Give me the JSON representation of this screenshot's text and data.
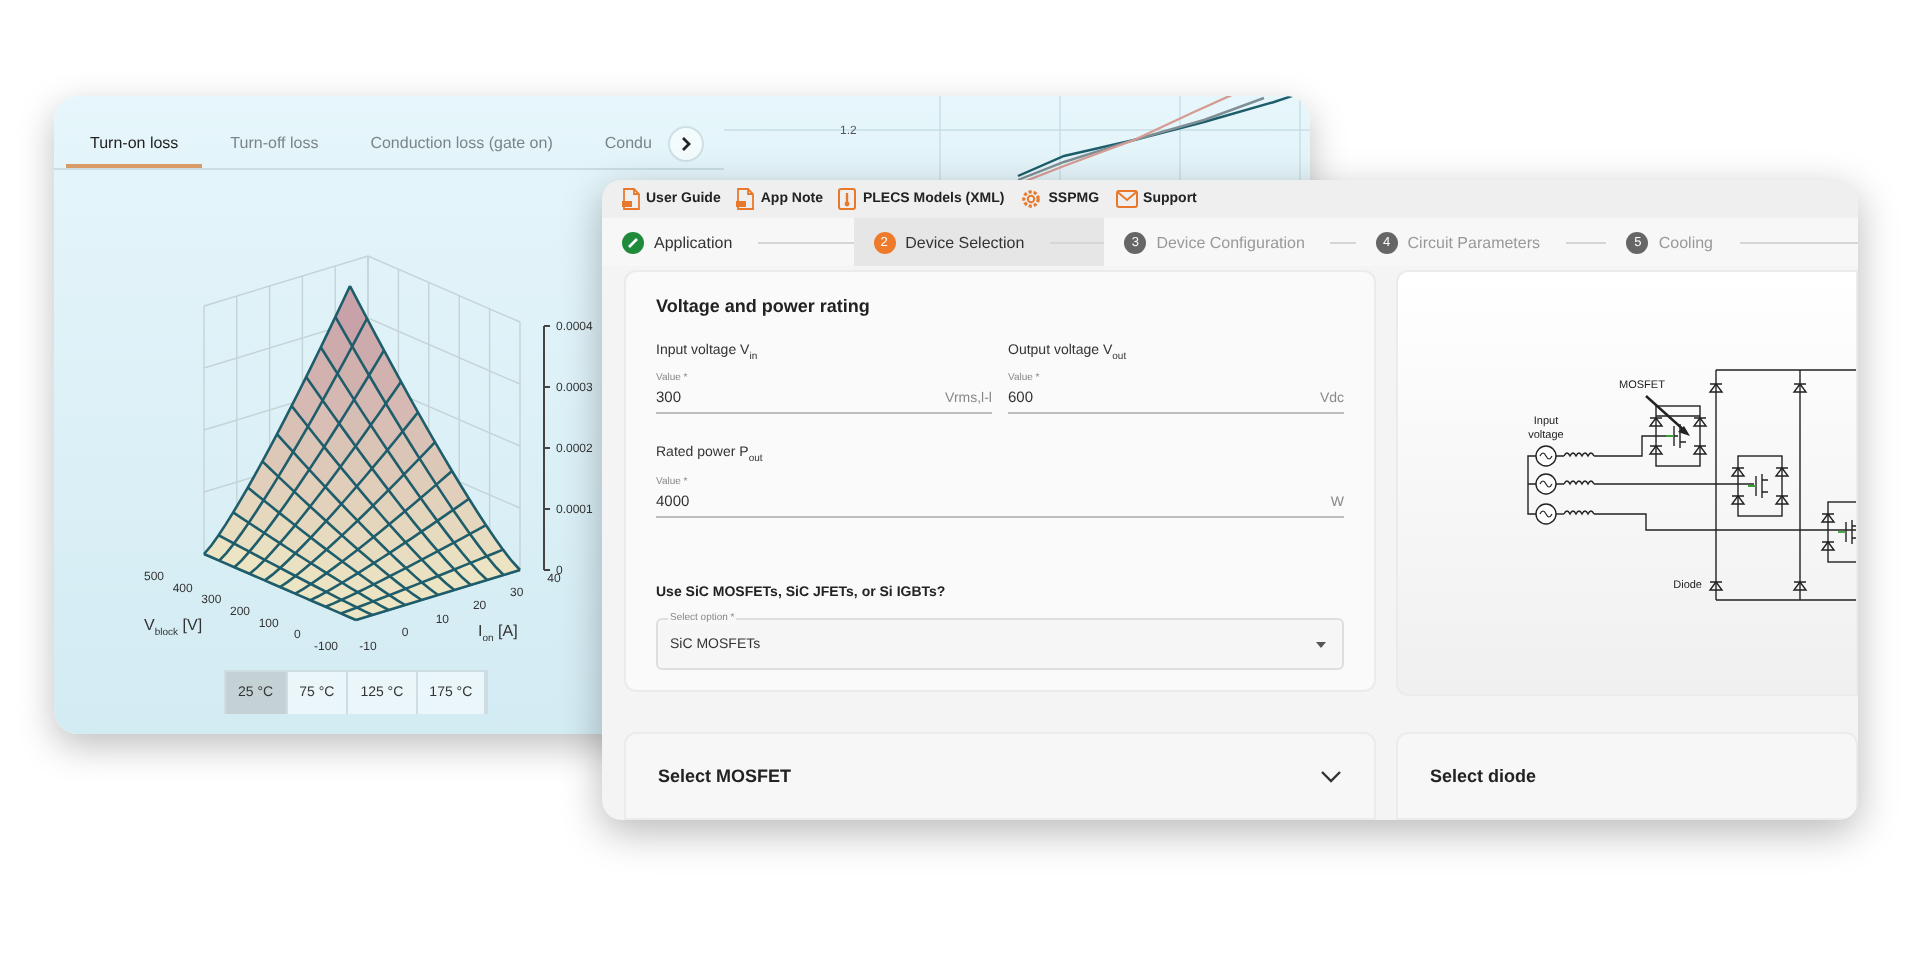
{
  "back_window": {
    "tabs": [
      {
        "label": "Turn-on loss",
        "selected": true
      },
      {
        "label": "Turn-off loss",
        "selected": false
      },
      {
        "label": "Conduction loss (gate on)",
        "selected": false
      },
      {
        "label": "Condu",
        "selected": false
      }
    ],
    "surface_plot": {
      "z_ticks": [
        "0.0004",
        "0.0003",
        "0.0002",
        "0.0001",
        "0"
      ],
      "v_ticks": [
        "500",
        "400",
        "300",
        "200",
        "100",
        "0",
        "-100"
      ],
      "i_ticks": [
        "-10",
        "0",
        "10",
        "20",
        "30",
        "40"
      ],
      "v_label": "V$_{block}$ [V]",
      "i_label": "I$_{on}$ [A]"
    },
    "temperatures": [
      {
        "label": "25 °C",
        "selected": true
      },
      {
        "label": "75 °C",
        "selected": false
      },
      {
        "label": "125 °C",
        "selected": false
      },
      {
        "label": "175 °C",
        "selected": false
      }
    ],
    "line_plot": {
      "y_tick": "1.2"
    }
  },
  "front_window": {
    "links": [
      {
        "label": "User Guide",
        "kind": "pdf"
      },
      {
        "label": "App Note",
        "kind": "pdf"
      },
      {
        "label": "PLECS Models (XML)",
        "kind": "model"
      },
      {
        "label": "SSPMG",
        "kind": "tool"
      },
      {
        "label": "Support",
        "kind": "mail"
      }
    ],
    "steps": [
      {
        "label": "Application",
        "kind": "done",
        "selected": false
      },
      {
        "label": "Device Selection",
        "number": "2",
        "kind": "current",
        "selected": true
      },
      {
        "label": "Device Configuration",
        "number": "3",
        "kind": "pending",
        "selected": false
      },
      {
        "label": "Circuit Parameters",
        "number": "4",
        "kind": "pending",
        "selected": false
      },
      {
        "label": "Cooling",
        "number": "5",
        "kind": "pending",
        "selected": false
      }
    ],
    "rating_card": {
      "title": "Voltage and power rating",
      "fields": [
        {
          "label": "Input voltage V$_{in}$",
          "caption": "Value *",
          "value": "300",
          "unit": "Vrms,l-l"
        },
        {
          "label": "Output voltage V$_{out}$",
          "caption": "Value *",
          "value": "600",
          "unit": "Vdc"
        },
        {
          "label": "Rated power P$_{out}$",
          "caption": "Value *",
          "value": "4000",
          "unit": "W"
        }
      ],
      "question": "Use SiC MOSFETs, SiC JFETs, or Si IGBTs?",
      "select": {
        "caption": "Select option *",
        "value": "SiC MOSFETs"
      }
    },
    "circuit": {
      "input_label": [
        "Input",
        "voltage"
      ],
      "switch_label": "MOSFET",
      "diode_label": "Diode"
    },
    "sections": [
      {
        "title": "Select MOSFET",
        "expandable": true
      },
      {
        "title": "Select diode",
        "expandable": false
      }
    ]
  }
}
